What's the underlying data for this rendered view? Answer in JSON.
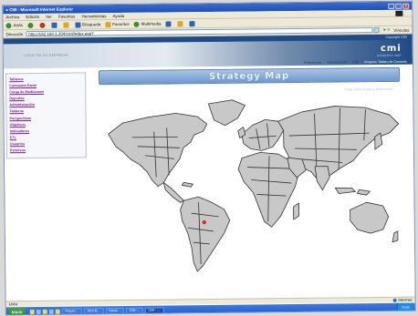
{
  "window": {
    "title": "CMI - Microsoft Internet Explorer"
  },
  "menubar": {
    "items": [
      "Archivo",
      "Edición",
      "Ver",
      "Favoritos",
      "Herramientas",
      "Ayuda"
    ]
  },
  "toolbar": {
    "back": "Atrás",
    "search": "Búsqueda",
    "favorites": "Favoritos",
    "multimedia": "Multimedia"
  },
  "address": {
    "label": "Dirección",
    "url": "http://192.168.1.204/cmi/index.asp?",
    "go": "Ir",
    "links": "Vínculos"
  },
  "app_header": {
    "company_logo_text": "LOGO DE SU EMPRESA",
    "product_name": "cmi",
    "product_subtitle": "STRATEGY MAP",
    "info_text": "Copyright CMI",
    "nav": [
      "Preferencias",
      "Administración",
      "Salir",
      "Proyecto: Tablero de Comando"
    ]
  },
  "sidebar": {
    "items": [
      "Tableros",
      "Command Panel",
      "Carga de Mediciones",
      "Reportes",
      "Administración",
      "Tableros",
      "Perspectivas",
      "Objetivos",
      "Indicadores",
      "ETL",
      "Usuarios",
      "Permisos"
    ]
  },
  "main": {
    "title": "Strategy Map",
    "map_note": "Pulse sobre el país a seleccionar"
  },
  "map": {
    "marker_color": "#e0281c",
    "land_color": "#c8c8c8",
    "outline_color": "#333333"
  },
  "statusbar": {
    "status": "Listo",
    "zone": "Internet"
  },
  "taskbar": {
    "start": "Inicio",
    "tasks": [
      "Proyec...",
      "ADV.R...",
      "Danie...",
      "CMI-...",
      "CMI - ..."
    ],
    "clock": "19:53"
  }
}
